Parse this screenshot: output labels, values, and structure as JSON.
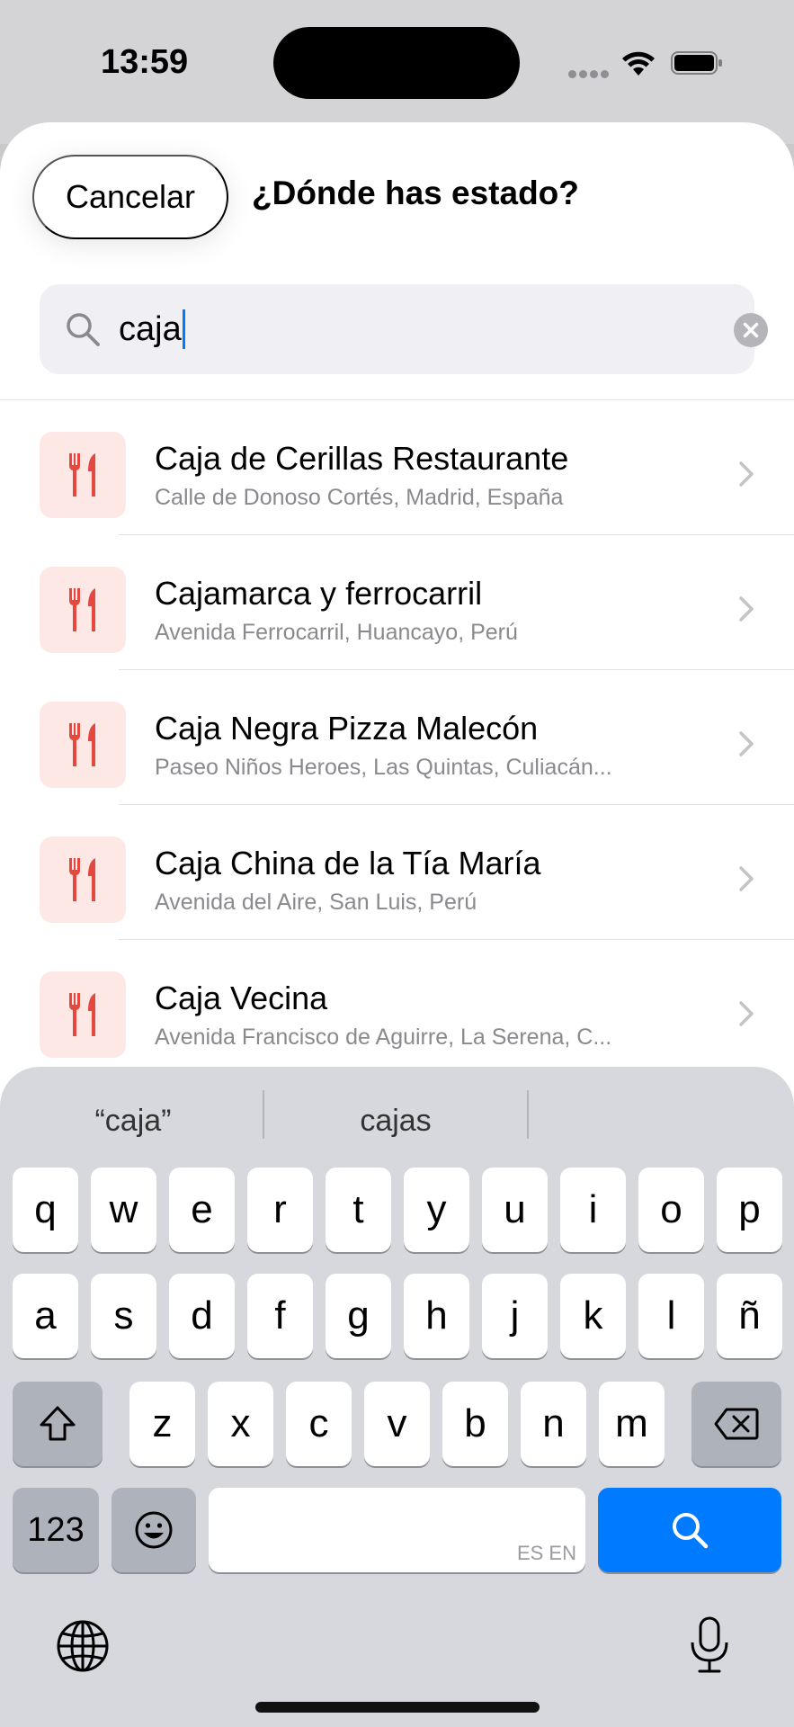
{
  "status_bar": {
    "time": "13:59"
  },
  "sheet": {
    "cancel_label": "Cancelar",
    "title": "¿Dónde has estado?"
  },
  "search": {
    "value": "caja"
  },
  "results": [
    {
      "name": "Caja de Cerillas Restaurante",
      "address": "Calle de Donoso Cortés, Madrid, España",
      "icon": "fork-knife-icon"
    },
    {
      "name": "Cajamarca y ferrocarril",
      "address": "Avenida Ferrocarril, Huancayo, Perú",
      "icon": "fork-knife-icon"
    },
    {
      "name": "Caja Negra Pizza Malecón",
      "address": "Paseo Niños Heroes, Las Quintas, Culiacán...",
      "icon": "fork-knife-icon"
    },
    {
      "name": "Caja China de la Tía María",
      "address": "Avenida del Aire, San Luis, Perú",
      "icon": "fork-knife-icon"
    },
    {
      "name": "Caja Vecina",
      "address": "Avenida Francisco de Aguirre, La Serena, C...",
      "icon": "fork-knife-icon"
    }
  ],
  "keyboard": {
    "suggestions": [
      "“caja”",
      "cajas",
      ""
    ],
    "row1": [
      "q",
      "w",
      "e",
      "r",
      "t",
      "y",
      "u",
      "i",
      "o",
      "p"
    ],
    "row2": [
      "a",
      "s",
      "d",
      "f",
      "g",
      "h",
      "j",
      "k",
      "l",
      "ñ"
    ],
    "row3": [
      "z",
      "x",
      "c",
      "v",
      "b",
      "n",
      "m"
    ],
    "numbers_label": "123",
    "language_hint": "ES EN"
  },
  "colors": {
    "accent": "#007aff",
    "icon_red": "#e5483f",
    "icon_tile": "#fde8e6"
  }
}
